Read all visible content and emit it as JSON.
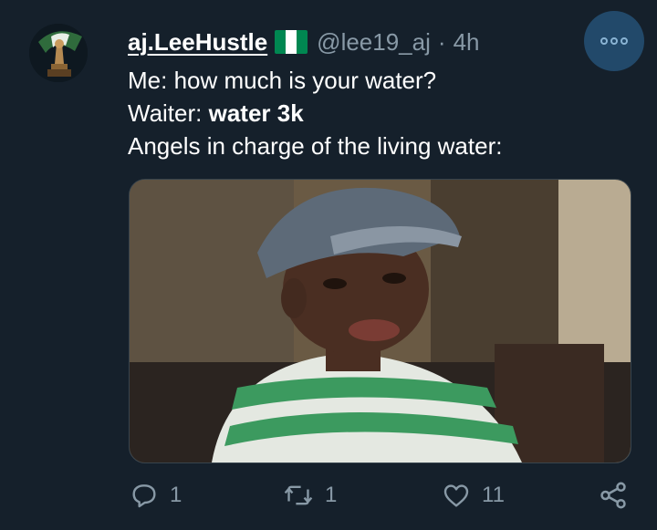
{
  "tweet": {
    "display_name": "aj.LeeHustle",
    "handle": "@lee19_aj",
    "separator": "·",
    "time": "4h",
    "lines": {
      "line1": "Me: how much is your water?",
      "line2_prefix": "Waiter: ",
      "line2_bold": "water 3k",
      "line3": "Angels in charge of the living water:"
    },
    "flag_colors": [
      "#008751",
      "#ffffff",
      "#008751"
    ],
    "media": {
      "kind": "photo",
      "colors": {
        "background": "#6a5a44",
        "cap": "#5d6a78",
        "shirt_green": "#3c9a5f",
        "shirt_white": "#e4e8e1",
        "skin": "#4a2e22"
      }
    }
  },
  "actions": {
    "reply": {
      "icon": "reply-icon",
      "count": "1"
    },
    "retweet": {
      "icon": "retweet-icon",
      "count": "1"
    },
    "like": {
      "icon": "heart-icon",
      "count": "11"
    },
    "share": {
      "icon": "share-icon"
    }
  },
  "colors": {
    "background": "#15202b",
    "secondary_text": "#8899a6",
    "more_button": "#22496a"
  }
}
